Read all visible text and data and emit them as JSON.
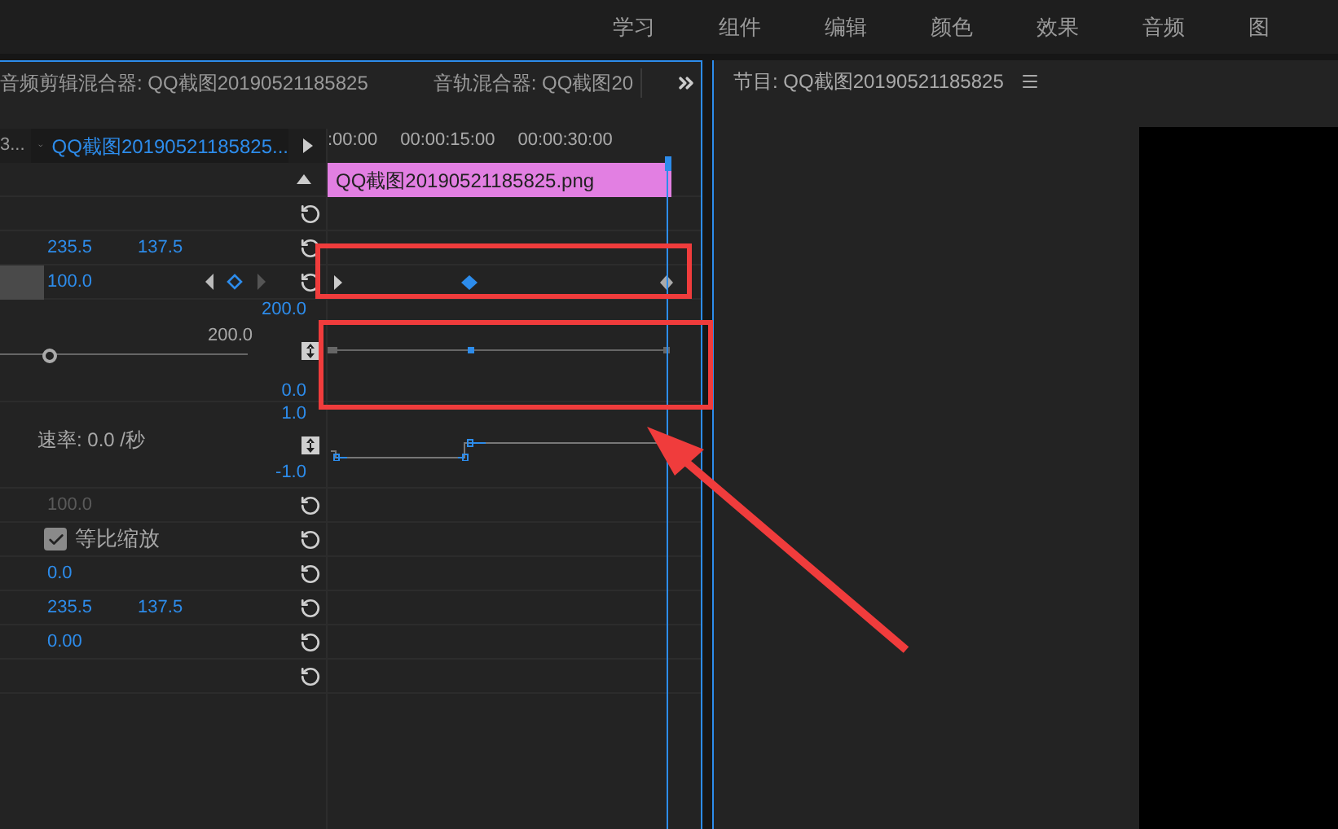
{
  "workspace_tabs": [
    "学习",
    "组件",
    "编辑",
    "颜色",
    "效果",
    "音频",
    "图"
  ],
  "panel_tabs": [
    {
      "label": "音频剪辑混合器: QQ截图20190521185825"
    },
    {
      "label": "音轨混合器: QQ截图20"
    }
  ],
  "effect_controls": {
    "source": "3...",
    "clip": "QQ截图20190521185825...",
    "ruler": [
      ":00:00",
      "00:00:15:00",
      "00:00:30:00"
    ],
    "clip_bar": "QQ截图20190521185825.png",
    "rows": [
      {
        "kind": "blank"
      },
      {
        "kind": "pair",
        "values": [
          "235.5",
          "137.5"
        ]
      },
      {
        "kind": "keyframed",
        "value": "100.0"
      },
      {
        "kind": "graph",
        "max": "200.0",
        "value": "200.0",
        "min": "0.0",
        "level": 0.2
      },
      {
        "kind": "velocity",
        "max": "1.0",
        "label": "速率: 0.0 /秒",
        "min": "-1.0"
      },
      {
        "kind": "value",
        "value": "100.0",
        "disabled": true
      },
      {
        "kind": "checkbox",
        "label": "等比缩放",
        "checked": true
      },
      {
        "kind": "value",
        "value": "0.0",
        "disabled": false
      },
      {
        "kind": "pair",
        "values": [
          "235.5",
          "137.5"
        ]
      },
      {
        "kind": "value",
        "value": "0.00",
        "disabled": false
      },
      {
        "kind": "blank"
      }
    ]
  },
  "program_monitor": {
    "title": "节目: QQ截图20190521185825"
  }
}
